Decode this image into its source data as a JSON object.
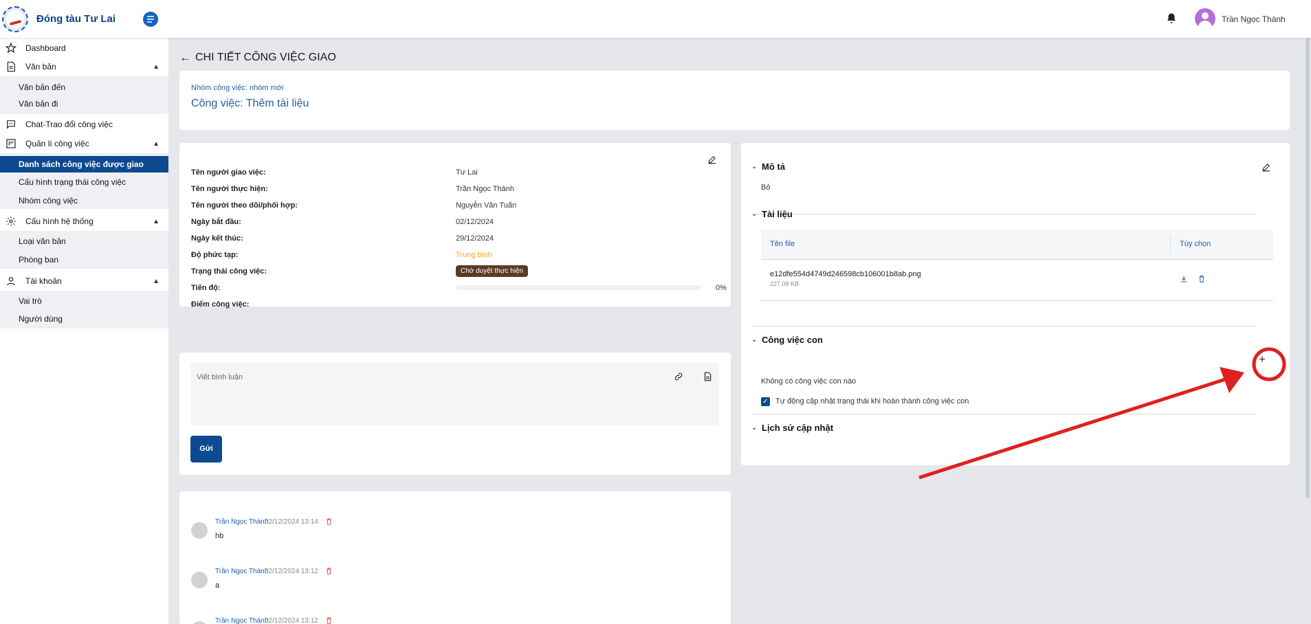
{
  "header": {
    "brand": "Đóng tàu Tư Lai",
    "user_name": "Trần Ngọc Thành"
  },
  "sidebar": {
    "items": [
      {
        "label": "Dashboard",
        "icon": "star-icon"
      },
      {
        "label": "Văn bản",
        "icon": "document-icon"
      },
      {
        "label": "Chat-Trao đổi công việc",
        "icon": "chat-icon"
      },
      {
        "label": "Quản lí công việc",
        "icon": "kanban-icon"
      },
      {
        "label": "Cấu hình hệ thống",
        "icon": "gear-icon"
      },
      {
        "label": "Tài khoản",
        "icon": "user-icon"
      }
    ],
    "van_ban_sub": [
      "Văn bản đến",
      "Văn bản đi"
    ],
    "quan_li_sub": [
      "Danh sách công việc được giao",
      "Cấu hình trạng thái công việc",
      "Nhóm công việc"
    ],
    "cau_hinh_sub": [
      "Loại văn bản",
      "Phòng ban"
    ],
    "tai_khoan_sub": [
      "Vai trò",
      "Người dùng"
    ]
  },
  "page": {
    "title": "CHI TIẾT CÔNG VIỆC GIAO",
    "group_link": "Nhóm công việc: nhóm mới",
    "task_title": "Công việc: Thêm tài liệu"
  },
  "info": {
    "rows": [
      {
        "label": "Tên người giao việc:",
        "value": "Tư Lai"
      },
      {
        "label": "Tên người thực hiện:",
        "value": "Trần Ngọc Thành"
      },
      {
        "label": "Tên người theo dõi/phối hợp:",
        "value": "Nguyễn Văn Tuấn"
      },
      {
        "label": "Ngày bắt đầu:",
        "value": "02/12/2024"
      },
      {
        "label": "Ngày kết thúc:",
        "value": "29/12/2024"
      },
      {
        "label": "Độ phức tạp:",
        "value": "Trung bình"
      },
      {
        "label": "Trạng thái công việc:",
        "value": "Chờ duyệt thực hiện"
      },
      {
        "label": "Tiến độ:",
        "value": "0%"
      },
      {
        "label": "Điểm công việc:",
        "value": ""
      }
    ],
    "progress_percent": 0,
    "complexity_color": "#f2a623",
    "status_color": "#5b3a25"
  },
  "comment_form": {
    "placeholder": "Viết bình luận",
    "send_label": "Gửi"
  },
  "comments": [
    {
      "author": "Trần Ngọc Thành",
      "time": "02/12/2024 13:14",
      "body": "hb"
    },
    {
      "author": "Trần Ngọc Thành",
      "time": "02/12/2024 13:12",
      "body": "a"
    },
    {
      "author": "Trần Ngọc Thành",
      "time": "02/12/2024 13:12",
      "body": ""
    }
  ],
  "right_panel": {
    "description_title": "Mô tả",
    "description_text": "Bỏ",
    "documents_title": "Tài liệu",
    "table_headers": [
      "Tên file",
      "Tùy chọn"
    ],
    "files": [
      {
        "name": "e12dfe554d4749d246598cb106001b8ab.png",
        "size": "227.09 KB"
      }
    ],
    "subtasks_title": "Công việc con",
    "no_subtasks": "Không có công việc con nào",
    "auto_update_label": "Tự động cập nhật trạng thái khi hoàn thành công việc con",
    "auto_update_checked": true,
    "history_title": "Lịch sử cập nhật"
  },
  "colors": {
    "primary": "#0d4a8f",
    "link": "#1e5fa8",
    "annotation": "#e02020"
  }
}
